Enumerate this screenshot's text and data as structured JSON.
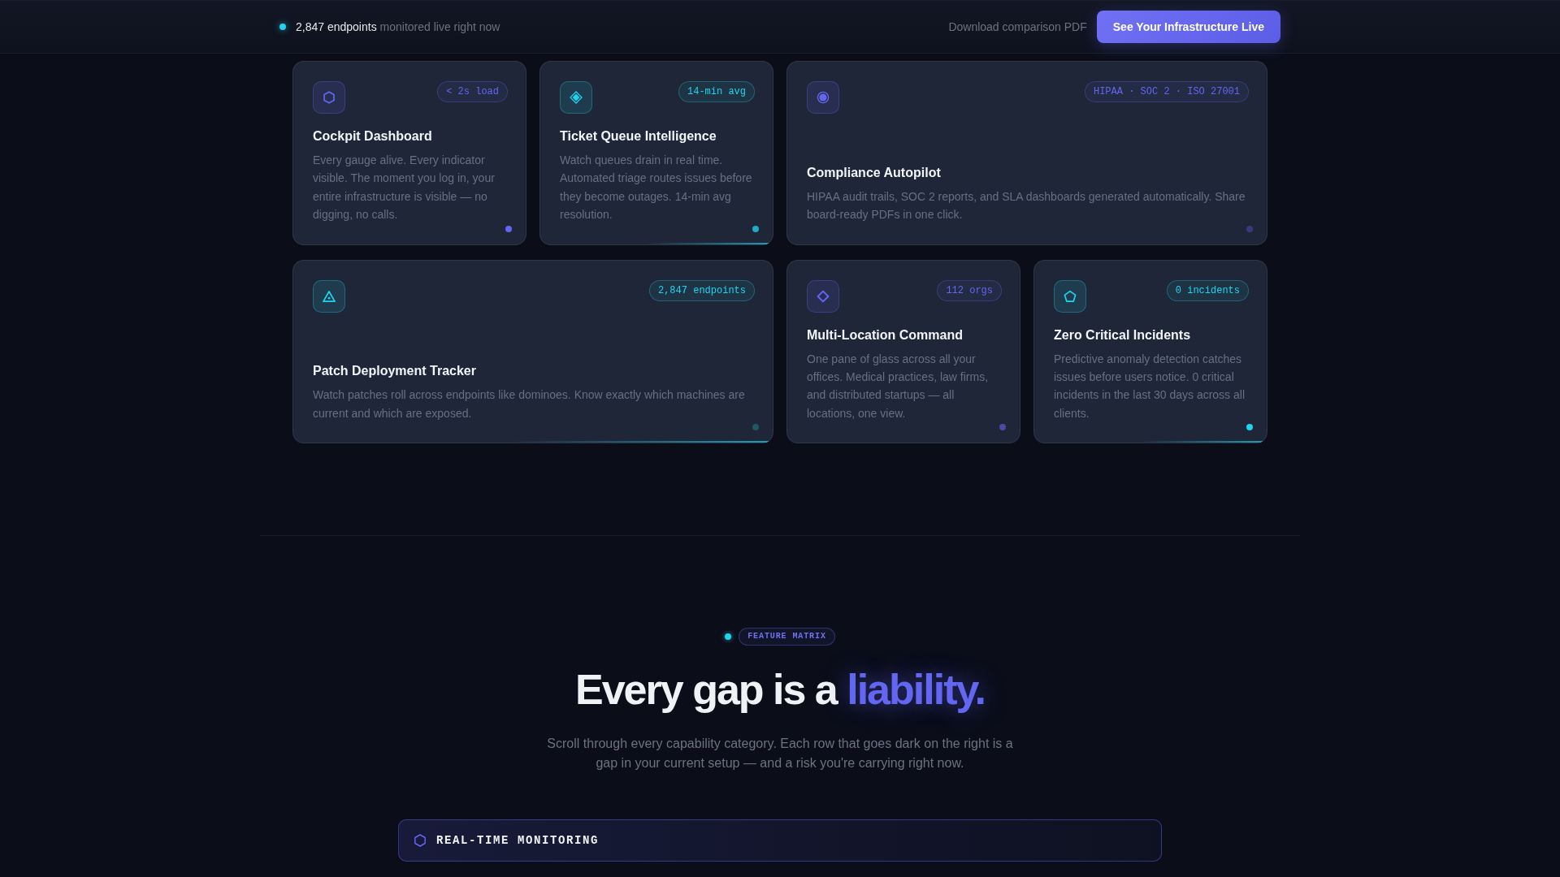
{
  "top_bar": {
    "live_count": "2,847 endpoints",
    "live_text": "monitored live right now",
    "link": "Download comparison PDF",
    "button": "See Your Infrastructure Live"
  },
  "cards": [
    {
      "badge": "< 2s load",
      "title": "Cockpit Dashboard",
      "description": "Every gauge alive. Every indicator visible. The moment you log in, your entire infrastructure is visible — no digging, no calls.",
      "icon": {
        "color": "#6366f1"
      },
      "status_dot": {
        "color": "#6366f1"
      },
      "wide": false,
      "glow": false
    },
    {
      "badge": "14-min avg",
      "title": "Ticket Queue Intelligence",
      "description": "Watch queues drain in real time. Automated triage routes issues before they become outages. 14-min avg resolution.",
      "icon": {
        "color": "#22d3ee"
      },
      "status_dot": {
        "color": "#22a9c4"
      },
      "wide": false,
      "glow": true
    },
    {
      "badge": "HIPAA · SOC 2 · ISO 27001",
      "title": "Compliance Autopilot",
      "description": "HIPAA audit trails, SOC 2 reports, and SLA dashboards generated automatically. Share board-ready PDFs in one click.",
      "icon": {
        "color": "#6366f1"
      },
      "status_dot": {
        "color": "#373b7e"
      },
      "wide": true,
      "glow": false
    },
    {
      "badge": "2,847 endpoints",
      "title": "Patch Deployment Tracker",
      "description": "Watch patches roll across endpoints like dominoes. Know exactly which machines are current and which are exposed.",
      "icon": {
        "color": "#22d3ee"
      },
      "status_dot": {
        "color": "#1e586a"
      },
      "wide": true,
      "glow": true
    },
    {
      "badge": "112 orgs",
      "title": "Multi-Location Command",
      "description": "One pane of glass across all your offices. Medical practices, law firms, and distributed startups — all locations, one view.",
      "icon": {
        "color": "#6366f1"
      },
      "status_dot": {
        "color": "#4b49a6"
      },
      "wide": false,
      "glow": false
    },
    {
      "badge": "0 incidents",
      "title": "Zero Critical Incidents",
      "description": "Predictive anomaly detection catches issues before users notice. 0 critical incidents in the last 30 days across all clients.",
      "icon": {
        "color": "#22d3ee"
      },
      "status_dot": {
        "color": "#22d3ee"
      },
      "wide": false,
      "glow": true
    }
  ],
  "feature_matrix": {
    "tag": "FEATURE MATRIX",
    "heading": "Every gap is a",
    "heading_highlight": "liability.",
    "subtitle": "Scroll through every capability category. Each row that goes dark on the right is a gap in your current setup — and a risk you're carrying right now.",
    "categories": [
      {
        "title": "REAL-TIME MONITORING"
      }
    ]
  }
}
